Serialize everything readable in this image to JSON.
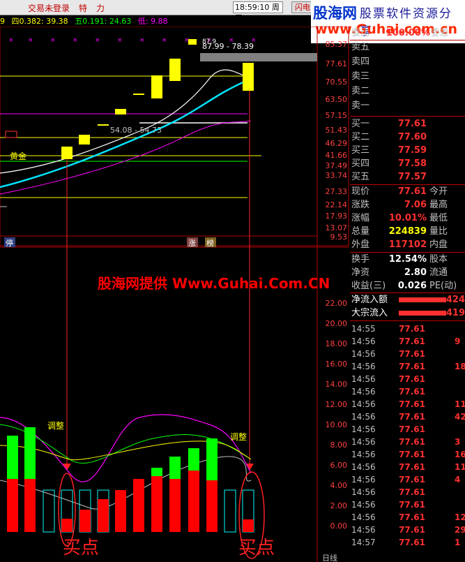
{
  "top_bar": {
    "menu": [
      "交易未登录",
      "特",
      "力"
    ],
    "time": "18:59:10",
    "weekday": "周三",
    "flash_button": "闪电"
  },
  "watermark": {
    "name": "股海网",
    "tagline": "股票软件资源分享",
    "url": "www.Guhai.com.cn",
    "promo": "股海网提供 Www.Guhai.Com.CN"
  },
  "indicator_line": {
    "prefix": "9",
    "items": [
      "四0.382: 39.38",
      "五0.191: 24.63",
      "低: 9.88"
    ]
  },
  "price_chart": {
    "y_labels": [
      "85.37",
      "77.61",
      "70.55",
      "63.50",
      "57.15",
      "51.43",
      "46.29",
      "41.66",
      "37.49",
      "33.74",
      "27.33",
      "22.14",
      "17.93",
      "13.07",
      "9.53"
    ],
    "annotations": {
      "high_range": "87.99 - 78.39",
      "high_price": "87.9",
      "mid_range": "54.08 - 54.73",
      "golden_label": "黄金",
      "stop_label": "停",
      "limit_label_1": "涨",
      "limit_label_2": "榜"
    }
  },
  "indicator_chart": {
    "y_labels": [
      "22.00",
      "20.00",
      "18.00",
      "16.00",
      "14.00",
      "12.00",
      "10.00",
      "8.00",
      "6.00",
      "4.00",
      "2.00",
      "0.00"
    ],
    "adjust_label": "调整",
    "buy_label": "买点",
    "bottom_label": "日线"
  },
  "colors": {
    "up": "#ff0000",
    "down": "#00ffff",
    "yellow": "#ffff00",
    "magenta": "#ff00ff",
    "green": "#00ff00",
    "panel_red": "#ff3030"
  },
  "quote": {
    "header": {
      "label_left": "委比",
      "value": "100.00%",
      "label_right": "委差"
    },
    "sell": [
      {
        "label": "卖五"
      },
      {
        "label": "卖四"
      },
      {
        "label": "卖三"
      },
      {
        "label": "卖二"
      },
      {
        "label": "卖一"
      }
    ],
    "buy": [
      {
        "label": "买一",
        "price": "77.61"
      },
      {
        "label": "买二",
        "price": "77.60"
      },
      {
        "label": "买三",
        "price": "77.59"
      },
      {
        "label": "买四",
        "price": "77.58"
      },
      {
        "label": "买五",
        "price": "77.57"
      }
    ],
    "stats": [
      {
        "label": "现价",
        "value": "77.61",
        "extra": "今开",
        "color": "#ff3030"
      },
      {
        "label": "涨跌",
        "value": "7.06",
        "extra": "最高",
        "color": "#ff3030"
      },
      {
        "label": "涨幅",
        "value": "10.01%",
        "extra": "最低",
        "color": "#ff3030"
      },
      {
        "label": "总量",
        "value": "224839",
        "extra": "量比",
        "color": "#ffff00"
      },
      {
        "label": "外盘",
        "value": "117102",
        "extra": "内盘",
        "color": "#ff3030"
      }
    ],
    "stats2": [
      {
        "label": "换手",
        "value": "12.54%",
        "extra": "股本",
        "color": "#c0c0c0"
      },
      {
        "label": "净资",
        "value": "2.80",
        "extra": "流通",
        "color": "#c0c0c0"
      },
      {
        "label": "收益(三)",
        "value": "0.026",
        "extra": "PE(动)",
        "color": "#c0c0c0"
      }
    ],
    "flows": [
      {
        "label": "净流入额",
        "value": "424"
      },
      {
        "label": "大宗流入",
        "value": "419"
      }
    ],
    "ticks": [
      {
        "time": "14:55",
        "price": "77.61",
        "vol": ""
      },
      {
        "time": "14:56",
        "price": "77.61",
        "vol": "9"
      },
      {
        "time": "14:56",
        "price": "77.61",
        "vol": ""
      },
      {
        "time": "14:56",
        "price": "77.61",
        "vol": "18"
      },
      {
        "time": "14:56",
        "price": "77.61",
        "vol": ""
      },
      {
        "time": "14:56",
        "price": "77.61",
        "vol": ""
      },
      {
        "time": "14:56",
        "price": "77.61",
        "vol": "11"
      },
      {
        "time": "14:56",
        "price": "77.61",
        "vol": "42"
      },
      {
        "time": "14:56",
        "price": "77.61",
        "vol": ""
      },
      {
        "time": "14:56",
        "price": "77.61",
        "vol": "3"
      },
      {
        "time": "14:56",
        "price": "77.61",
        "vol": "16"
      },
      {
        "time": "14:56",
        "price": "77.61",
        "vol": "11"
      },
      {
        "time": "14:56",
        "price": "77.61",
        "vol": "4"
      },
      {
        "time": "14:56",
        "price": "77.61",
        "vol": ""
      },
      {
        "time": "14:56",
        "price": "77.61",
        "vol": ""
      },
      {
        "time": "14:56",
        "price": "77.61",
        "vol": "12"
      },
      {
        "time": "14:56",
        "price": "77.61",
        "vol": "29"
      },
      {
        "time": "14:57",
        "price": "77.61",
        "vol": "1"
      }
    ]
  }
}
